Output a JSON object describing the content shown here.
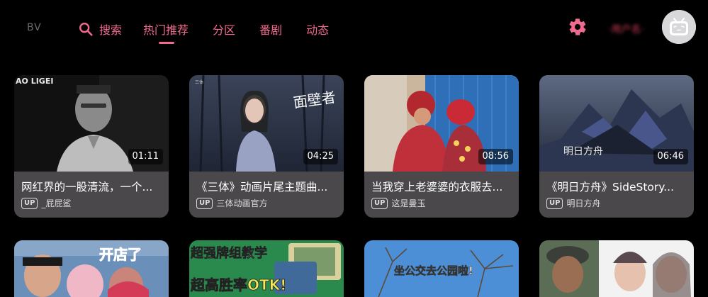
{
  "app": {
    "logo": "BV"
  },
  "nav": {
    "search": "搜索",
    "items": [
      "热门推荐",
      "分区",
      "番剧",
      "动态"
    ],
    "active_index": 0
  },
  "user": {
    "name": "·用户名·"
  },
  "colors": {
    "accent": "#f06a8e",
    "card_bg": "#4a484b",
    "background": "#000000"
  },
  "videos": [
    {
      "title": "网红界的一股清流，一个...",
      "up_badge": "UP",
      "uploader": "_屁屁鲨",
      "duration": "01:11",
      "thumb_text": "AO LIGEI"
    },
    {
      "title": "《三体》动画片尾主题曲...",
      "up_badge": "UP",
      "uploader": "三体动画官方",
      "duration": "04:25",
      "thumb_text": "面壁者"
    },
    {
      "title": "当我穿上老婆婆的衣服去...",
      "up_badge": "UP",
      "uploader": "这是曼玉",
      "duration": "08:56"
    },
    {
      "title": "《明日方舟》SideStory...",
      "up_badge": "UP",
      "uploader": "明日方舟",
      "duration": "06:46",
      "thumb_text": "明日方舟"
    }
  ],
  "row2": [
    {
      "thumb_text": "开店了"
    },
    {
      "thumb_text": "超强牌组教学",
      "thumb_text2": "超高胜率OTK!"
    },
    {
      "thumb_text": "坐公交去公园啦!"
    },
    {
      "thumb_text": ""
    }
  ]
}
